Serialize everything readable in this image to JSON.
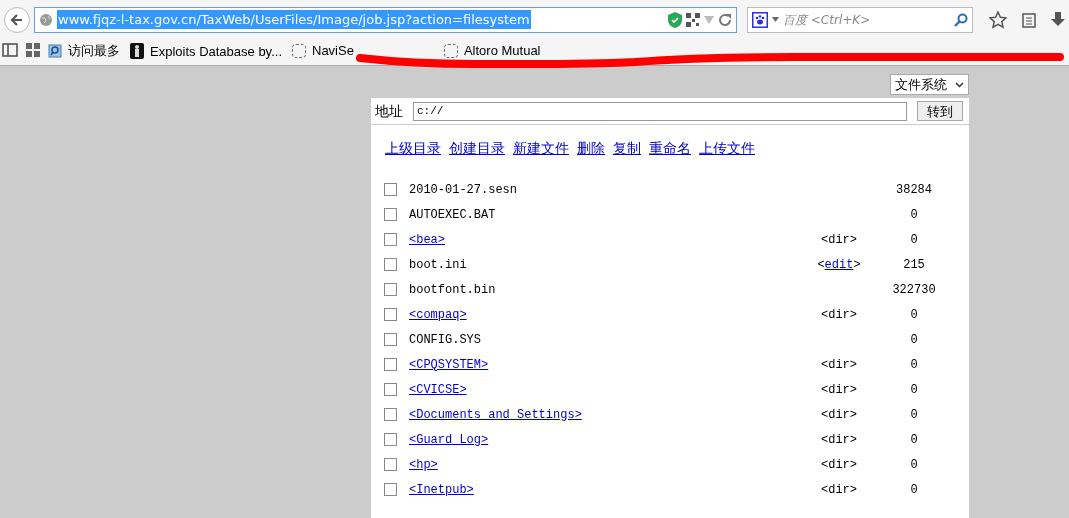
{
  "browser": {
    "url": "www.fjqz-l-tax.gov.cn/TaxWeb/UserFiles/Image/job.jsp?action=filesystem",
    "search_placeholder": "百度 <Ctrl+K>"
  },
  "bookmarks": [
    {
      "label": "访问最多",
      "kind": "search"
    },
    {
      "label": "Exploits Database by...",
      "kind": "figure"
    },
    {
      "label": "NaviSe",
      "kind": "blank"
    },
    {
      "label": "Altoro Mutual",
      "kind": "blank"
    }
  ],
  "mode_select": {
    "value": "文件系统"
  },
  "address": {
    "label": "地址",
    "value": "c://",
    "button": "转到"
  },
  "actions": [
    "上级目录",
    "创建目录",
    "新建文件",
    "删除",
    "复制",
    "重命名",
    "上传文件"
  ],
  "files": [
    {
      "name": "2010-01-27.sesn",
      "kind": "file",
      "size": "38284",
      "checked": false
    },
    {
      "name": "AUTOEXEC.BAT",
      "kind": "file",
      "size": "0",
      "checked": false
    },
    {
      "name": "<bea>",
      "kind": "dir",
      "tag": "<dir>",
      "size": "0",
      "checked": false
    },
    {
      "name": "boot.ini",
      "kind": "editable",
      "tag_open": "<",
      "tag": "edit",
      "tag_close": ">",
      "size": "215",
      "checked": false
    },
    {
      "name": "bootfont.bin",
      "kind": "file",
      "size": "322730",
      "checked": false
    },
    {
      "name": "<compaq>",
      "kind": "dir",
      "tag": "<dir>",
      "size": "0",
      "checked": false
    },
    {
      "name": "CONFIG.SYS",
      "kind": "file",
      "size": "0",
      "checked": false
    },
    {
      "name": "<CPQSYSTEM>",
      "kind": "dir",
      "tag": "<dir>",
      "size": "0",
      "checked": false
    },
    {
      "name": "<CVICSE>",
      "kind": "dir",
      "tag": "<dir>",
      "size": "0",
      "checked": false
    },
    {
      "name": "<Documents and Settings>",
      "kind": "dir",
      "tag": "<dir>",
      "size": "0",
      "checked": false
    },
    {
      "name": "<Guard_Log>",
      "kind": "dir",
      "tag": "<dir>",
      "size": "0",
      "checked": false
    },
    {
      "name": "<hp>",
      "kind": "dir",
      "tag": "<dir>",
      "size": "0",
      "checked": false
    },
    {
      "name": "<Inetpub>",
      "kind": "dir",
      "tag": "<dir>",
      "size": "0",
      "checked": false
    }
  ]
}
